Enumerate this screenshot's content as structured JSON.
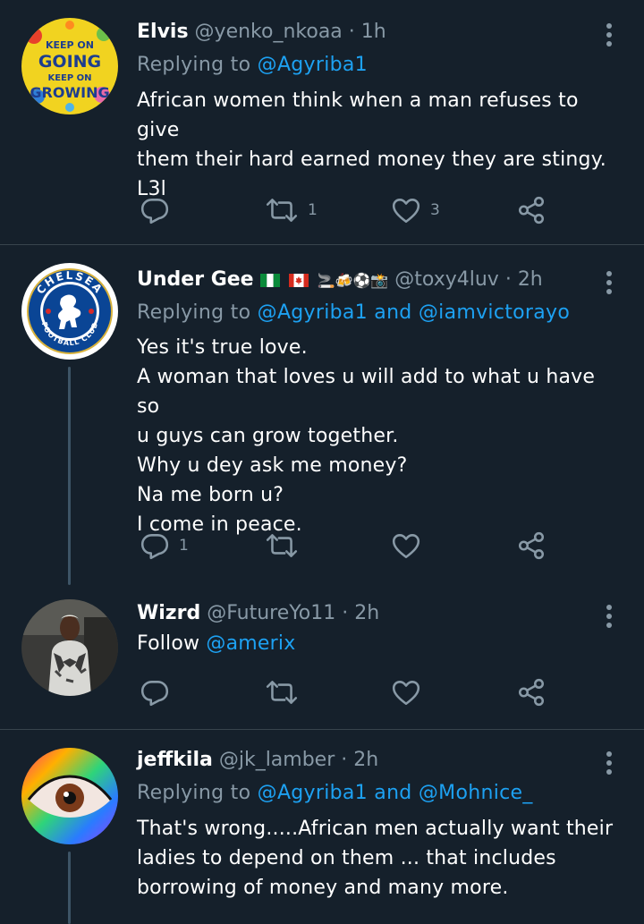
{
  "tweets": [
    {
      "name": "Elvis",
      "handle": "@yenko_nkoaa",
      "time": "· 1h",
      "replying_prefix": "Replying to",
      "replying_to": "@Agyriba1",
      "body": [
        "African women think when a man refuses to give",
        "them their hard earned money they are stingy.",
        "L3l"
      ],
      "retweets": "1",
      "likes": "3",
      "avatar_text": [
        "KEEP ON",
        "GOING",
        "KEEP ON",
        "GROWING"
      ]
    },
    {
      "name": "Under Gee",
      "name_emojis": "🚬🍻⚽📸",
      "handle": "@toxy4luv",
      "time": "· 2h",
      "replying_prefix": "Replying to",
      "replying_to": "@Agyriba1",
      "replying_and": "and",
      "replying_to_2": "@iamvictorayo",
      "body": [
        "Yes it's true love.",
        "A woman that loves u will add to what u have so",
        "u guys can grow together.",
        "Why u dey ask me money?",
        "Na me born u?",
        "I come in peace."
      ],
      "replies": "1",
      "avatar_text": [
        "CHELSEA",
        "FOOTBALL CLUB"
      ]
    },
    {
      "name": "Wizrd",
      "handle": "@FutureYo11",
      "time": "· 2h",
      "body_prefix": "Follow",
      "body_mention": "@amerix"
    },
    {
      "name": "jeffkila",
      "handle": "@jk_lamber",
      "time": "· 2h",
      "replying_prefix": "Replying to",
      "replying_to": "@Agyriba1",
      "replying_and": "and",
      "replying_to_2": "@Mohnice_",
      "body": [
        "That's wrong.....African men actually want their",
        "ladies to depend on them ... that includes",
        "borrowing of money and many more."
      ]
    }
  ],
  "icons": {
    "reply": "reply-icon",
    "retweet": "retweet-icon",
    "like": "heart-icon",
    "share": "share-icon",
    "more": "more-vertical-icon"
  },
  "colors": {
    "background": "#15202b",
    "accent": "#1da1f2",
    "muted": "#8899a6",
    "divider": "#38444d"
  }
}
